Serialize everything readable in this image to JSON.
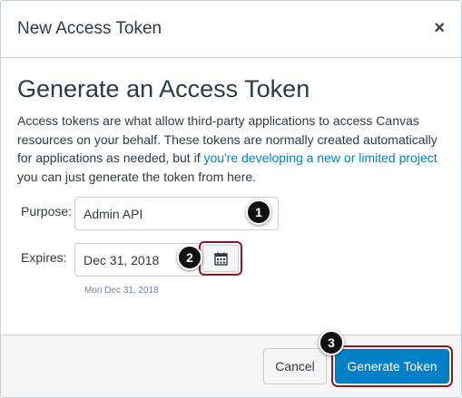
{
  "dialog": {
    "title": "New Access Token",
    "close_label": "×"
  },
  "content": {
    "heading": "Generate an Access Token",
    "description_before": "Access tokens are what allow third-party applications to access Canvas resources on your behalf. These tokens are normally created automatically for applications as needed, but if ",
    "description_link": "you're developing a new or limited project",
    "description_after": " you can just generate the token from here."
  },
  "form": {
    "purpose_label": "Purpose:",
    "purpose_value": "Admin API",
    "expires_label": "Expires:",
    "expires_value": "Dec 31, 2018",
    "expires_hint": "Mon Dec 31, 2018"
  },
  "footer": {
    "cancel_label": "Cancel",
    "generate_label": "Generate Token"
  },
  "annotations": [
    "1",
    "2",
    "3"
  ],
  "icons": {
    "close": "close-icon",
    "calendar": "calendar-icon"
  },
  "colors": {
    "link": "#0081c7",
    "primary_button": "#0081c7",
    "highlight_outline": "#8b1a22",
    "badge": "#111111"
  }
}
